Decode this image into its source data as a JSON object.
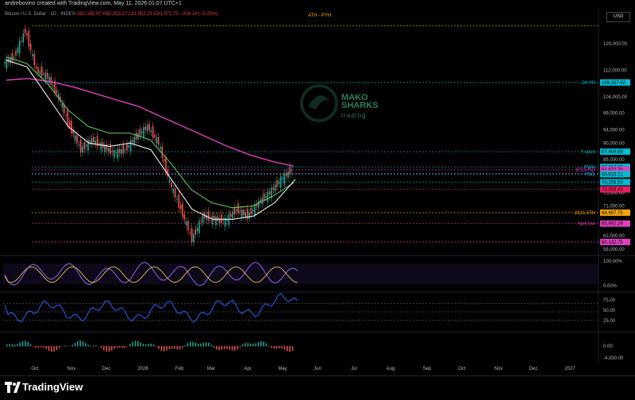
{
  "header": {
    "created": "andrebovino created with TradingView.com, May 11, 2026 01:07 UTC+1",
    "symbol": "Bitcoin / U.S. Dollar · 1D · INDEX",
    "ohlc": "O82,180.97 H82,353.27 L81,952.25 C81,972.70 −204.14 (−0.25%)",
    "currency": "USD",
    "ath_label": "ATH - PYH"
  },
  "footer": {
    "brand": "TradingView"
  },
  "watermark": {
    "line1": "MAKO",
    "line2": "SHARKS",
    "line3": "trading"
  },
  "colors": {
    "price": "#d1d4dc",
    "ma_fast": "#ffffff",
    "ma_mid": "#5fd35f",
    "ma_slow": "#e040c0",
    "ath": "#f7a600",
    "bull": "#26a69a",
    "bear": "#ef5350"
  },
  "chart_data": {
    "type": "line",
    "x": [
      "Oct",
      "Nov",
      "Dec",
      "2026",
      "Feb",
      "Mar",
      "Apr",
      "May",
      "Jun",
      "Jul",
      "Aug",
      "Sep",
      "Oct",
      "Nov",
      "Dec",
      "2027"
    ],
    "ylim": [
      57000,
      126000
    ],
    "y_ticks": [
      "120,000.00",
      "112,000.00",
      "104,000.00",
      "99,000.00",
      "94,000.00",
      "90,000.00",
      "85,000.00",
      "80,000.00",
      "75,000.00",
      "71,000.00",
      "66,000.00",
      "62,000.00",
      "58,000.00"
    ],
    "price_series": [
      {
        "d": "Oct",
        "v": 114000
      },
      {
        "d": "Oct",
        "v": 116000
      },
      {
        "d": "Oct",
        "v": 124000
      },
      {
        "d": "Oct",
        "v": 112000
      },
      {
        "d": "Nov",
        "v": 110000
      },
      {
        "d": "Nov",
        "v": 104000
      },
      {
        "d": "Nov",
        "v": 95000
      },
      {
        "d": "Nov",
        "v": 88000
      },
      {
        "d": "Dec",
        "v": 91000
      },
      {
        "d": "Dec",
        "v": 89000
      },
      {
        "d": "Dec",
        "v": 87000
      },
      {
        "d": "2026",
        "v": 88000
      },
      {
        "d": "2026",
        "v": 92000
      },
      {
        "d": "2026",
        "v": 95000
      },
      {
        "d": "2026",
        "v": 90000
      },
      {
        "d": "Feb",
        "v": 78000
      },
      {
        "d": "Feb",
        "v": 70000
      },
      {
        "d": "Feb",
        "v": 61000
      },
      {
        "d": "Feb",
        "v": 68000
      },
      {
        "d": "Mar",
        "v": 67000
      },
      {
        "d": "Mar",
        "v": 66500
      },
      {
        "d": "Mar",
        "v": 70000
      },
      {
        "d": "Apr",
        "v": 68000
      },
      {
        "d": "Apr",
        "v": 72000
      },
      {
        "d": "Apr",
        "v": 75000
      },
      {
        "d": "May",
        "v": 79000
      },
      {
        "d": "May",
        "v": 81972.7
      }
    ],
    "ma_fast": [
      115000,
      113000,
      104000,
      95000,
      90000,
      89000,
      90000,
      88000,
      79000,
      70000,
      67000,
      67000,
      68000,
      72000,
      79000
    ],
    "ma_mid": [
      116000,
      114000,
      108000,
      100000,
      95000,
      93000,
      93000,
      91000,
      84000,
      76000,
      72000,
      70500,
      71000,
      74000,
      78000
    ],
    "ma_slow": [
      109000,
      109500,
      108500,
      107000,
      105000,
      103000,
      101000,
      98000,
      95000,
      92000,
      89000,
      86500,
      84500,
      83000
    ],
    "levels": [
      {
        "label": "",
        "tag": "",
        "value": 125400,
        "color": "#f7a600"
      },
      {
        "label": "'24 YH",
        "tag": "108,287.62",
        "value": 108287.62,
        "color": "#00bcd4"
      },
      {
        "label": "Y-open",
        "tag": "87,404.69",
        "value": 87404.69,
        "color": "#00bcd4"
      },
      {
        "label": "PWH",
        "tag": "82,814.03",
        "value": 82814.03,
        "color": "#00bcd4"
      },
      {
        "label": "BTCUSD",
        "tag": "81,972.70",
        "value": 81972.7,
        "color": "#e040c0"
      },
      {
        "label": "",
        "tag": "23:52:06",
        "value": 80900,
        "color": "#e040c0"
      },
      {
        "label": "PWL",
        "tag": "80,619.71",
        "value": 80619.71,
        "color": "#00bcd4"
      },
      {
        "label": "",
        "tag": "78,196.53",
        "value": 78196.53,
        "color": "#00bcd4"
      },
      {
        "label": "",
        "tag": "76,008.43",
        "value": 76008.43,
        "color": "#e91e63"
      },
      {
        "label": "2021 ATH",
        "tag": "68,997.75",
        "value": 68997.75,
        "color": "#f7a600"
      },
      {
        "label": "April low",
        "tag": "65,692.29",
        "value": 65692.29,
        "color": "#e040c0"
      },
      {
        "label": "",
        "tag": "60,132.75",
        "value": 60132.75,
        "color": "#e040c0"
      }
    ],
    "rsi_ticks": [
      "100.00%",
      "0.00%"
    ],
    "stoch_ticks": [
      "75.00",
      "50.00",
      "25.00"
    ],
    "macd_ticks": [
      "0.00",
      "-4,000.00"
    ]
  }
}
